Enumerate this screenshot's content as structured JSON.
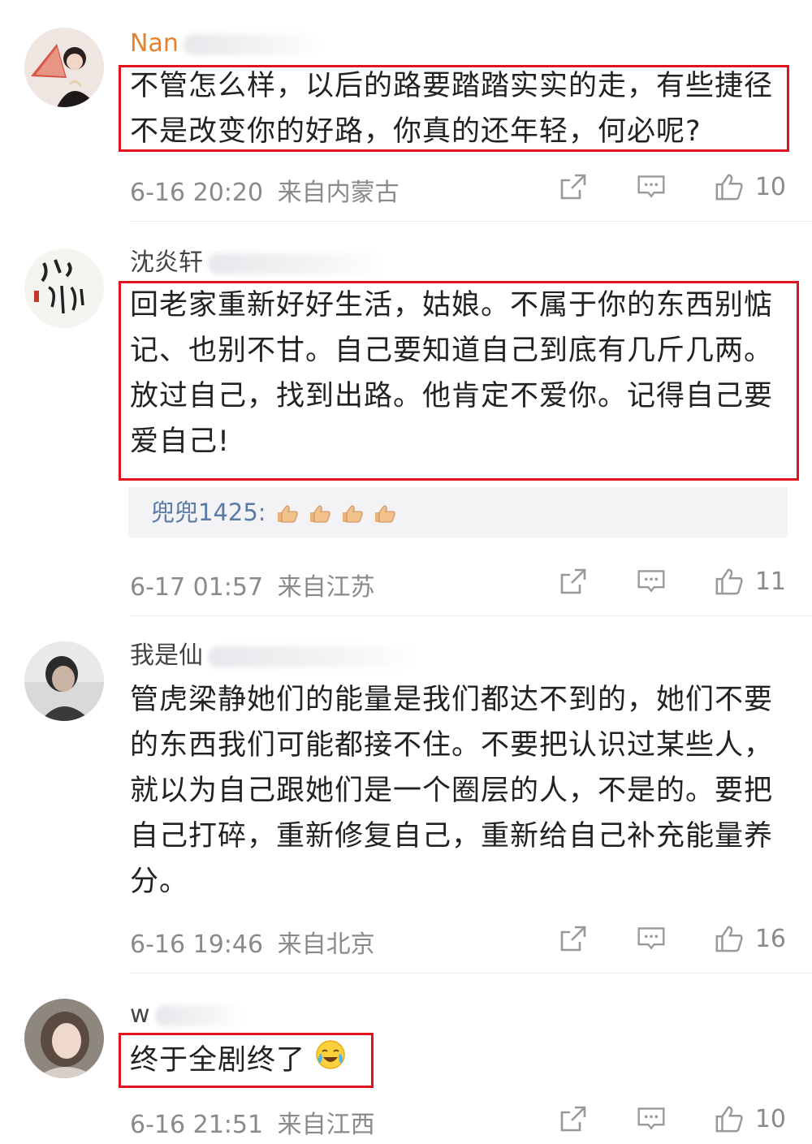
{
  "comments": [
    {
      "username": "Nan",
      "text": "不管怎么样，以后的路要踏踏实实的走，有些捷径不是改变你的好路，你真的还年轻，何必呢?",
      "time": "6-16 20:20",
      "location": "来自内蒙古",
      "likes": "10"
    },
    {
      "username": "沈炎轩",
      "text": "回老家重新好好生活，姑娘。不属于你的东西别惦记、也别不甘。自己要知道自己到底有几斤几两。放过自己，找到出路。他肯定不爱你。记得自己要爱自己!",
      "reply": {
        "user": "兜兜1425:",
        "text": ""
      },
      "time": "6-17 01:57",
      "location": "来自江苏",
      "likes": "11"
    },
    {
      "username": "我是仙",
      "text": "管虎梁静她们的能量是我们都达不到的，她们不要的东西我们可能都接不住。不要把认识过某些人，就以为自己跟她们是一个圈层的人，不是的。要把自己打碎，重新修复自己，重新给自己补充能量养分。",
      "time": "6-16 19:46",
      "location": "来自北京",
      "likes": "16"
    },
    {
      "username": "w",
      "text": "终于全剧终了",
      "time": "6-16 21:51",
      "location": "来自江西",
      "likes": "10"
    }
  ],
  "colors": {
    "highlight": "#e0141f",
    "username_accent": "#e5822b",
    "meta": "#8a8a8a",
    "reply_user": "#5b7aa6"
  },
  "icons": {
    "share": "share-icon",
    "comment": "comment-icon",
    "like": "thumbs-up-icon",
    "reply_emoji": "thumbs-up-emoji",
    "crying_emoji": "crying-laughing-emoji"
  }
}
